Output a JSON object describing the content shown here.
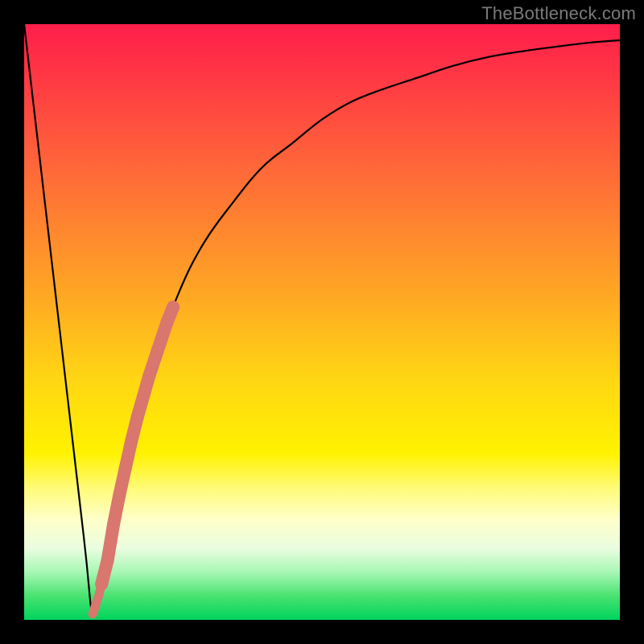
{
  "attribution": "TheBottleneck.com",
  "chart_data": {
    "type": "line",
    "title": "",
    "xlabel": "",
    "ylabel": "",
    "xlim": [
      0,
      100
    ],
    "ylim": [
      0,
      100
    ],
    "grid": false,
    "legend": false,
    "series": [
      {
        "name": "bottleneck-curve",
        "x": [
          0,
          5,
          10,
          11.5,
          13,
          15,
          18,
          22,
          26,
          30,
          35,
          40,
          45,
          50,
          55,
          60,
          66,
          72,
          78,
          84,
          90,
          95,
          100
        ],
        "values": [
          100,
          57,
          14,
          1,
          6,
          16,
          30,
          44,
          55,
          63,
          70,
          76,
          80,
          84,
          87,
          89,
          91,
          93,
          94.5,
          95.5,
          96.3,
          96.9,
          97.3
        ]
      },
      {
        "name": "highlight-bead-segment",
        "x": [
          13,
          14,
          15,
          16,
          17,
          18,
          19,
          20,
          21,
          22,
          23,
          24,
          25
        ],
        "values": [
          6,
          10,
          16,
          21,
          25.5,
          30,
          34,
          37.5,
          41,
          44,
          47,
          50,
          52.5
        ]
      },
      {
        "name": "highlight-bead-tail",
        "x": [
          11.5,
          12,
          12.5,
          13
        ],
        "values": [
          1,
          2.5,
          4,
          6
        ]
      }
    ],
    "colors": {
      "curve": "#000000",
      "bead": "#d9766e"
    }
  }
}
